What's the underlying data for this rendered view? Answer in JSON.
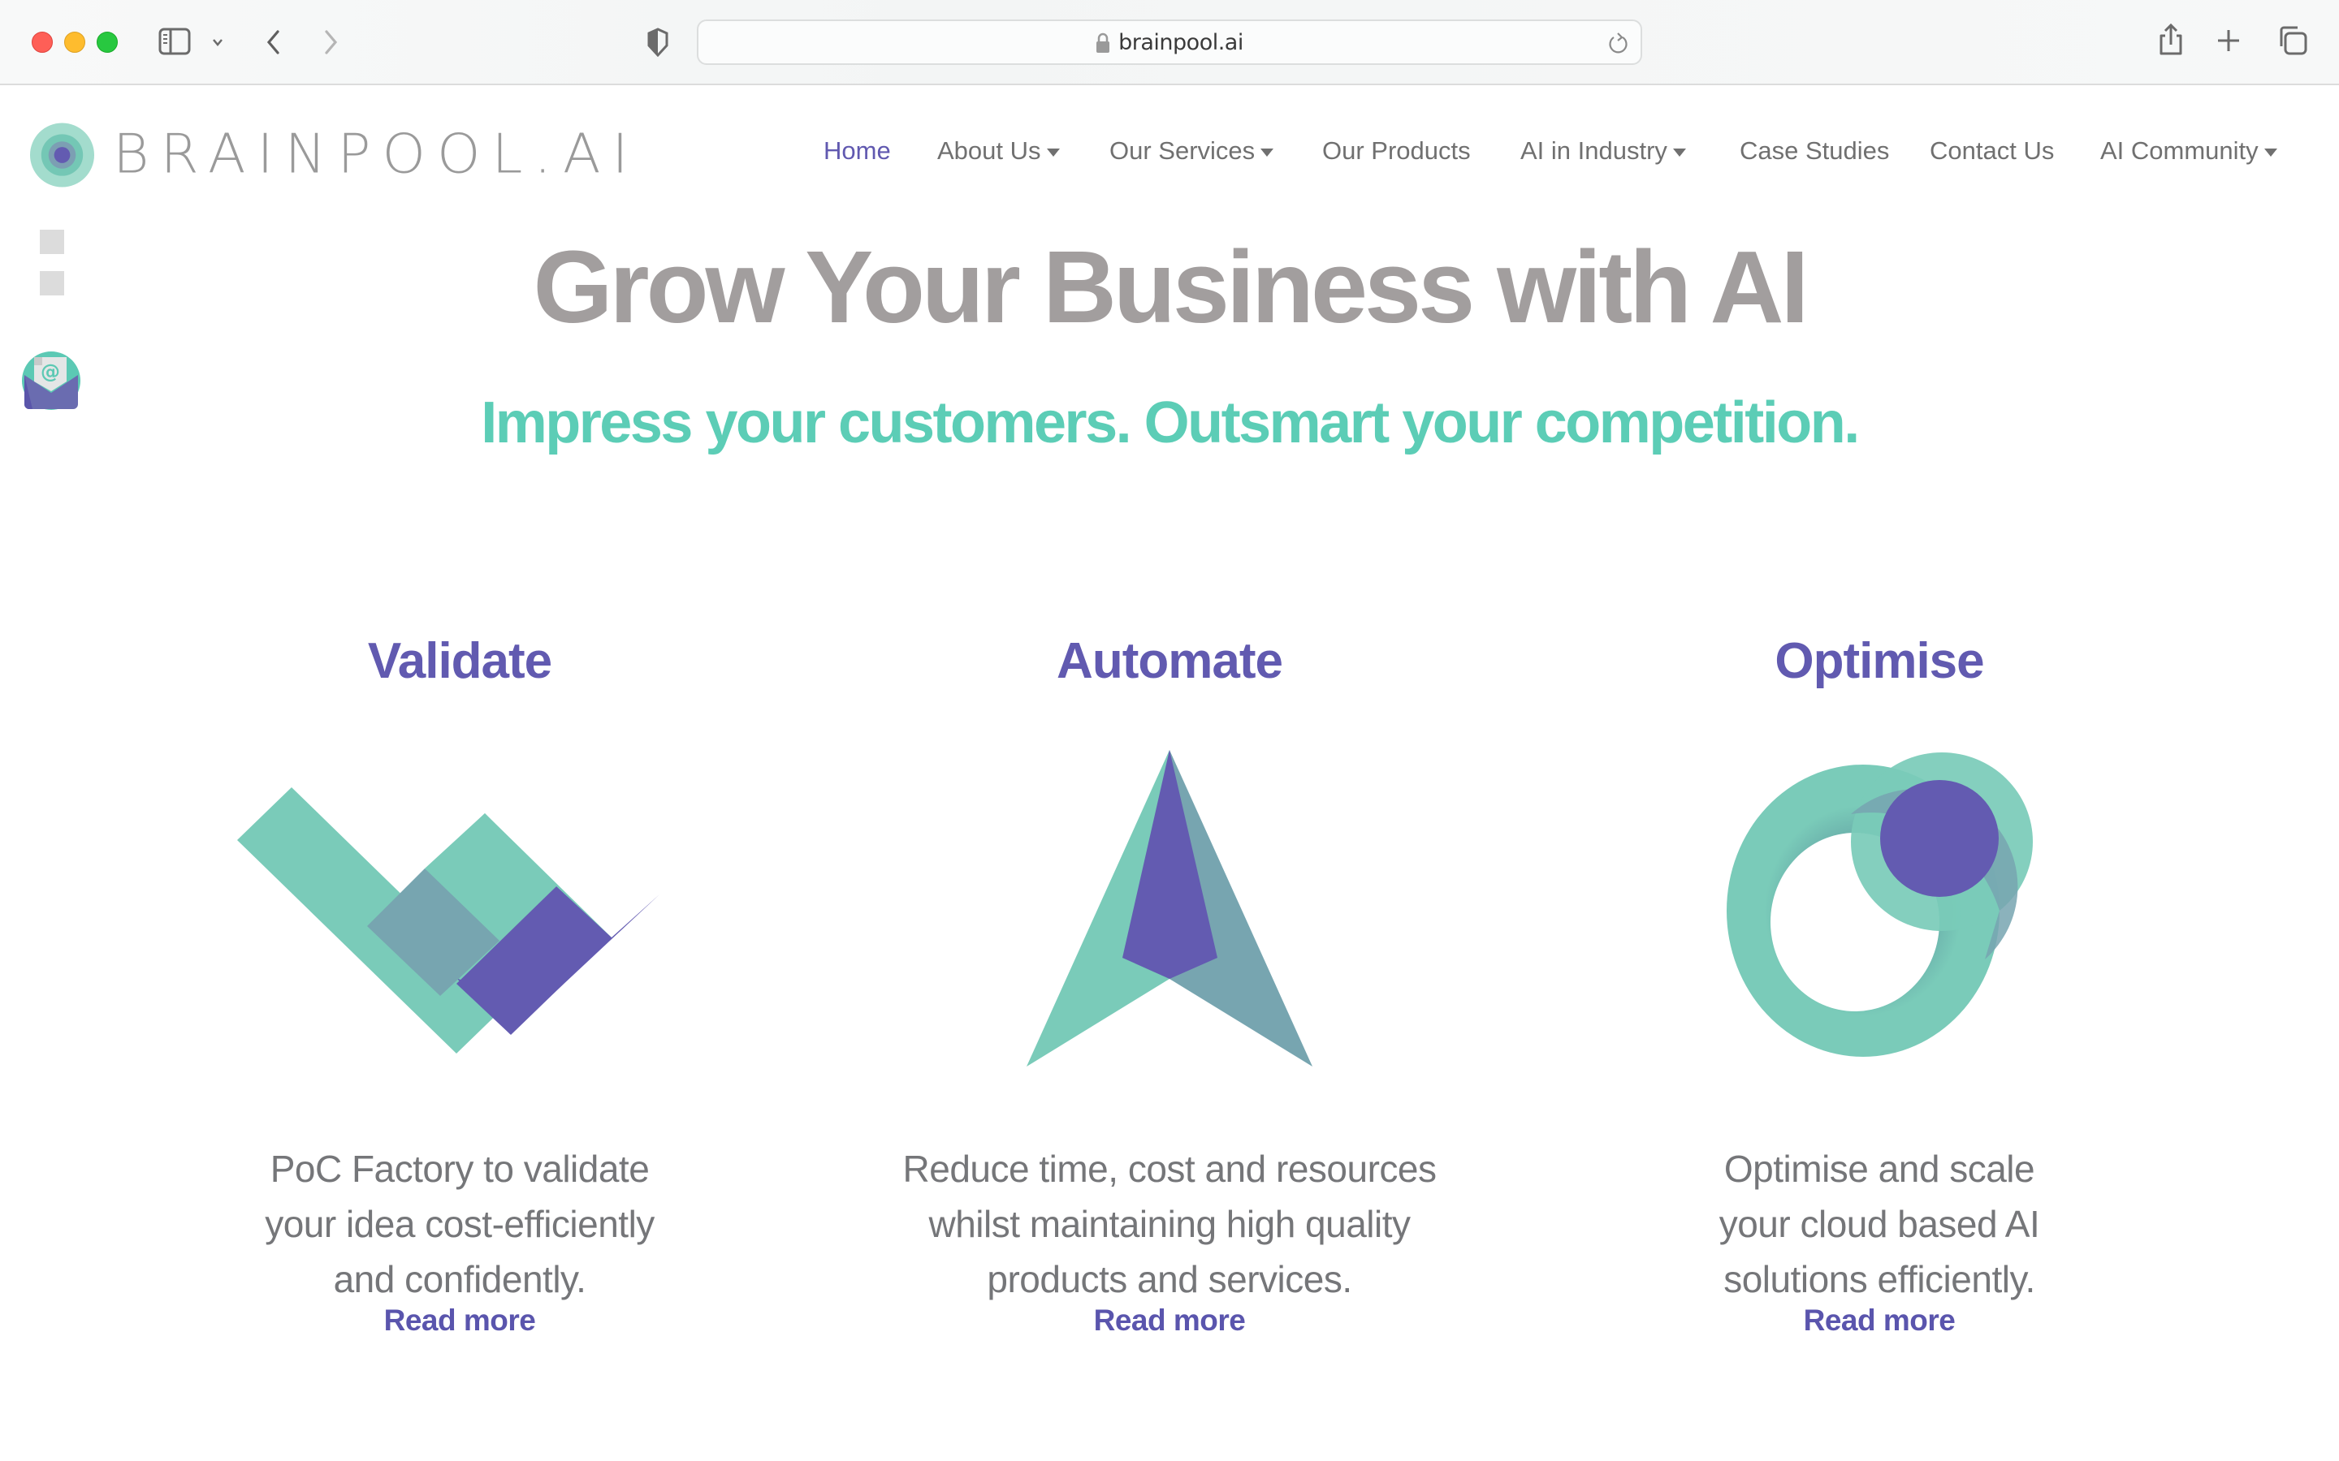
{
  "browser": {
    "url": "brainpool.ai",
    "icons": {
      "sidebar": "sidebar-icon",
      "tab_dropdown": "chevron-down-icon",
      "back": "chevron-left-icon",
      "forward": "chevron-right-icon",
      "privacy": "shield-icon",
      "lock": "lock-icon",
      "reload": "reload-icon",
      "share": "share-icon",
      "new_tab": "plus-icon",
      "tab_overview": "tabs-icon"
    }
  },
  "site": {
    "logo_text": "BRAINPOOL.AI",
    "nav": [
      {
        "label": "Home",
        "active": true,
        "dropdown": false
      },
      {
        "label": "About Us",
        "active": false,
        "dropdown": true
      },
      {
        "label": "Our Services",
        "active": false,
        "dropdown": true
      },
      {
        "label": "Our Products",
        "active": false,
        "dropdown": false
      },
      {
        "label": "AI in Industry",
        "active": false,
        "dropdown": true
      },
      {
        "label": "Case Studies",
        "active": false,
        "dropdown": false
      },
      {
        "label": "Contact Us",
        "active": false,
        "dropdown": false
      },
      {
        "label": "AI Community",
        "active": false,
        "dropdown": true
      }
    ]
  },
  "hero": {
    "title": "Grow Your Business with AI",
    "subtitle": "Impress your customers. Outsmart your competition."
  },
  "features": [
    {
      "title": "Validate",
      "icon": "validate-check-icon",
      "description_lines": [
        "PoC Factory to validate",
        "your idea cost-efficiently",
        "and confidently."
      ],
      "link": "Read more"
    },
    {
      "title": "Automate",
      "icon": "automate-arrow-icon",
      "description_lines": [
        "Reduce time, cost and resources",
        "whilst maintaining high quality",
        "products and services."
      ],
      "link": "Read more"
    },
    {
      "title": "Optimise",
      "icon": "optimise-rings-icon",
      "description_lines": [
        "Optimise and scale",
        "your cloud based AI",
        "solutions efficiently."
      ],
      "link": "Read more"
    }
  ],
  "colors": {
    "brand_purple": "#615ab0",
    "brand_teal": "#5ccdb6",
    "icon_teal": "#7acbb9",
    "icon_overlap": "#77a5b0",
    "title_gray": "#a29e9e",
    "body_gray": "#757679"
  }
}
